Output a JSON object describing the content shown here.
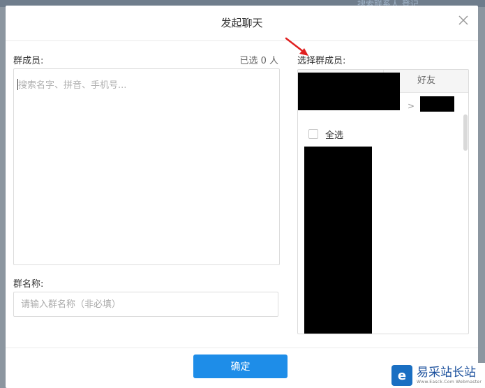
{
  "background": {
    "text": "搜索联系人  登记"
  },
  "dialog": {
    "title": "发起聊天"
  },
  "left": {
    "members_label": "群成员:",
    "selected_count": "已选 0 人",
    "search_placeholder": "搜索名字、拼音、手机号...",
    "group_name_label": "群名称:",
    "group_name_placeholder": "请输入群名称（非必填）"
  },
  "right": {
    "select_label": "选择群成员:",
    "tab_friends": "好友",
    "breadcrumb_separator": ">",
    "select_all_label": "全选"
  },
  "footer": {
    "confirm_label": "确定"
  },
  "watermark": {
    "logo_letter": "e",
    "text": "易采站长站",
    "sub": "Www.Easck.Com Webmaster"
  },
  "colors": {
    "accent": "#1e8de8",
    "arrow": "#e02020"
  }
}
